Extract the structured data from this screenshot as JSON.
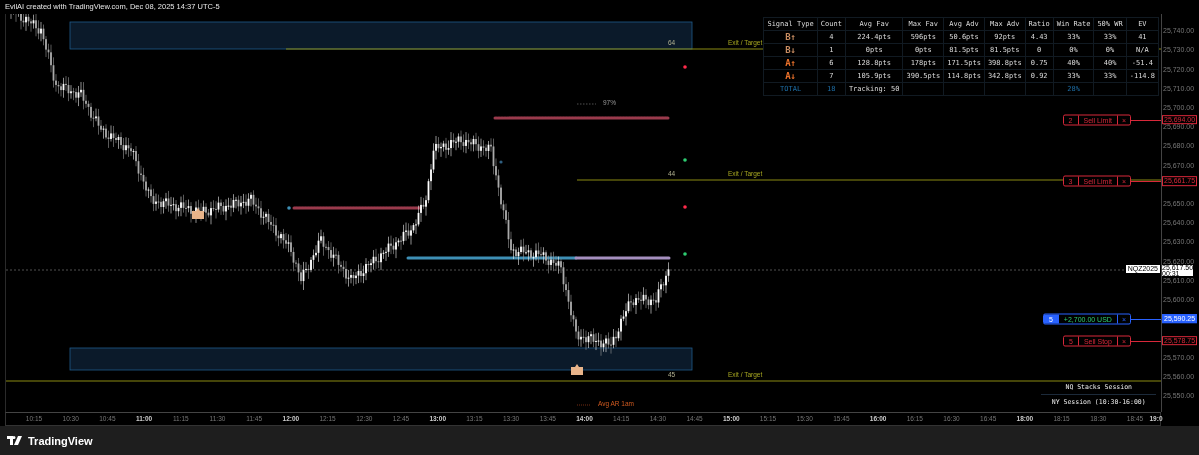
{
  "header": {
    "title": "EvilAI created with TradingView.com, Dec 08, 2025 14:37 UTC-5"
  },
  "stats_table": {
    "columns": [
      "Signal Type",
      "Count",
      "Avg Fav",
      "Max Fav",
      "Avg Adv",
      "Max Adv",
      "Ratio",
      "Win Rate",
      "50% WR",
      "EV"
    ],
    "rows": [
      {
        "cells": [
          "B↑",
          "4",
          "224.4pts",
          "596pts",
          "50.6pts",
          "92pts",
          "4.43",
          "33%",
          "33%",
          "41"
        ],
        "color": "#c98d62"
      },
      {
        "cells": [
          "B↓",
          "1",
          "0pts",
          "0pts",
          "81.5pts",
          "81.5pts",
          "0",
          "0%",
          "0%",
          "N/A"
        ],
        "color": "#c98d62"
      },
      {
        "cells": [
          "A↑",
          "6",
          "128.8pts",
          "178pts",
          "171.5pts",
          "398.8pts",
          "0.75",
          "40%",
          "40%",
          "-51.4"
        ],
        "color": "#e8702a"
      },
      {
        "cells": [
          "A↓",
          "7",
          "105.9pts",
          "390.5pts",
          "114.8pts",
          "342.8pts",
          "0.92",
          "33%",
          "33%",
          "-114.8"
        ],
        "color": "#e8702a"
      }
    ],
    "total": {
      "label": "TOTAL",
      "count": "18",
      "tracking": "Tracking: 50",
      "win_rate": "28%"
    }
  },
  "levels": [
    {
      "number": "64",
      "tag": "Exit / Target"
    },
    {
      "number": "44",
      "tag": "Exit / Target"
    },
    {
      "number": "45",
      "tag": "Exit / Target"
    }
  ],
  "annotations": {
    "probability": "97%",
    "average": "Avg AR 1am"
  },
  "orders": [
    {
      "kind": "limit",
      "qty": "2",
      "label": "Sell Limit",
      "close": "×",
      "price": "25,694.00"
    },
    {
      "kind": "limit",
      "qty": "3",
      "label": "Sell Limit",
      "close": "×",
      "price": "25,661.75"
    },
    {
      "kind": "position",
      "qty": "5",
      "label": "+2,700.00 USD",
      "close": "×",
      "price": "25,590.25"
    },
    {
      "kind": "stop",
      "qty": "5",
      "label": "Sell Stop",
      "close": "×",
      "price": "25,578.75"
    }
  ],
  "last_price": {
    "symbol": "NQZ2025",
    "price": "25,617.50",
    "countdown": "00:31"
  },
  "price_ticks": [
    "25,740.00",
    "25,730.00",
    "25,720.00",
    "25,710.00",
    "25,700.00",
    "25,690.00",
    "25,680.00",
    "25,670.00",
    "25,650.00",
    "25,640.00",
    "25,630.00",
    "25,620.00",
    "25,610.00",
    "25,600.00",
    "25,570.00",
    "25,560.00",
    "25,550.00"
  ],
  "time_ticks": [
    {
      "label": "10:15",
      "major": false
    },
    {
      "label": "10:30",
      "major": false
    },
    {
      "label": "10:45",
      "major": false
    },
    {
      "label": "11:00",
      "major": true
    },
    {
      "label": "11:15",
      "major": false
    },
    {
      "label": "11:30",
      "major": false
    },
    {
      "label": "11:45",
      "major": false
    },
    {
      "label": "12:00",
      "major": true
    },
    {
      "label": "12:15",
      "major": false
    },
    {
      "label": "12:30",
      "major": false
    },
    {
      "label": "12:45",
      "major": false
    },
    {
      "label": "13:00",
      "major": true
    },
    {
      "label": "13:15",
      "major": false
    },
    {
      "label": "13:30",
      "major": false
    },
    {
      "label": "13:45",
      "major": false
    },
    {
      "label": "14:00",
      "major": true
    },
    {
      "label": "14:15",
      "major": false
    },
    {
      "label": "14:30",
      "major": false
    },
    {
      "label": "14:45",
      "major": false
    },
    {
      "label": "15:00",
      "major": true
    },
    {
      "label": "15:15",
      "major": false
    },
    {
      "label": "15:30",
      "major": false
    },
    {
      "label": "15:45",
      "major": false
    },
    {
      "label": "16:00",
      "major": true
    },
    {
      "label": "16:15",
      "major": false
    },
    {
      "label": "16:30",
      "major": false
    },
    {
      "label": "16:45",
      "major": false
    },
    {
      "label": "18:00",
      "major": true
    },
    {
      "label": "18:15",
      "major": false
    },
    {
      "label": "18:30",
      "major": false
    },
    {
      "label": "18:45",
      "major": false
    },
    {
      "label": "19:0",
      "major": true
    }
  ],
  "session": {
    "name": "NQ Stacks Session",
    "hours": "NY Session (10:30-16:00)"
  },
  "footer": {
    "brand": "TradingView"
  }
}
